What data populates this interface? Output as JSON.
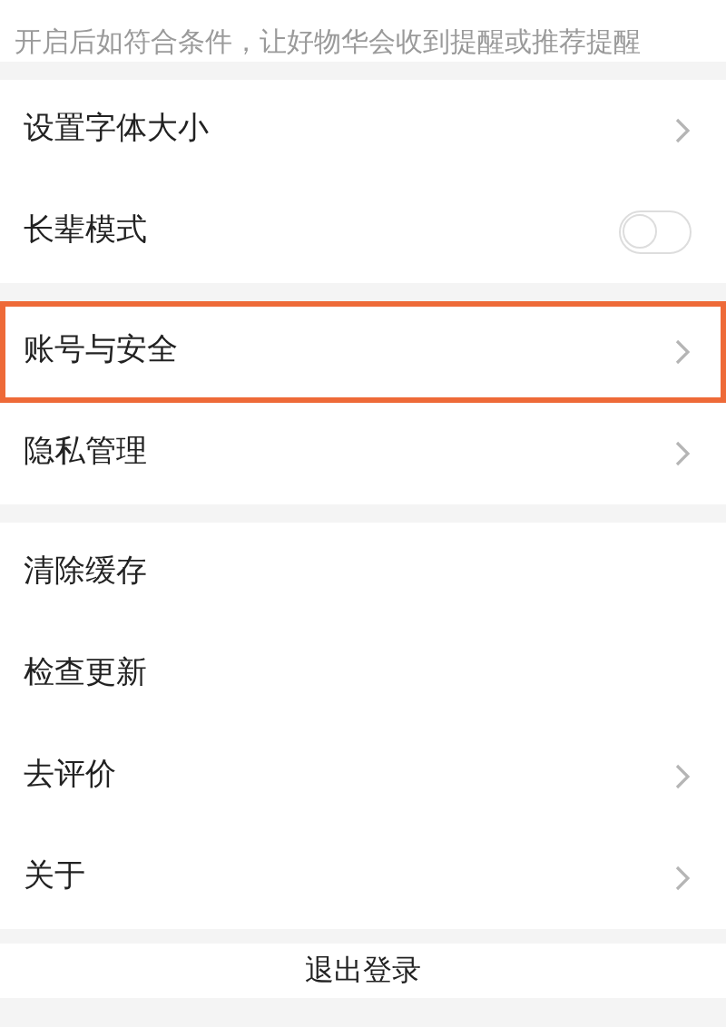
{
  "notice": "开启后如符合条件，让好物华会收到提醒或推荐提醒",
  "groups": [
    {
      "items": [
        {
          "label": "设置字体大小",
          "kind": "link",
          "highlighted": false
        },
        {
          "label": "长辈模式",
          "kind": "toggle",
          "on": false,
          "highlighted": false
        }
      ]
    },
    {
      "items": [
        {
          "label": "账号与安全",
          "kind": "link",
          "highlighted": true
        },
        {
          "label": "隐私管理",
          "kind": "link",
          "highlighted": false
        }
      ]
    },
    {
      "items": [
        {
          "label": "清除缓存",
          "kind": "plain",
          "highlighted": false
        },
        {
          "label": "检查更新",
          "kind": "plain",
          "highlighted": false
        },
        {
          "label": "去评价",
          "kind": "link",
          "highlighted": false
        },
        {
          "label": "关于",
          "kind": "link",
          "highlighted": false
        }
      ]
    }
  ],
  "logout": "退出登录"
}
